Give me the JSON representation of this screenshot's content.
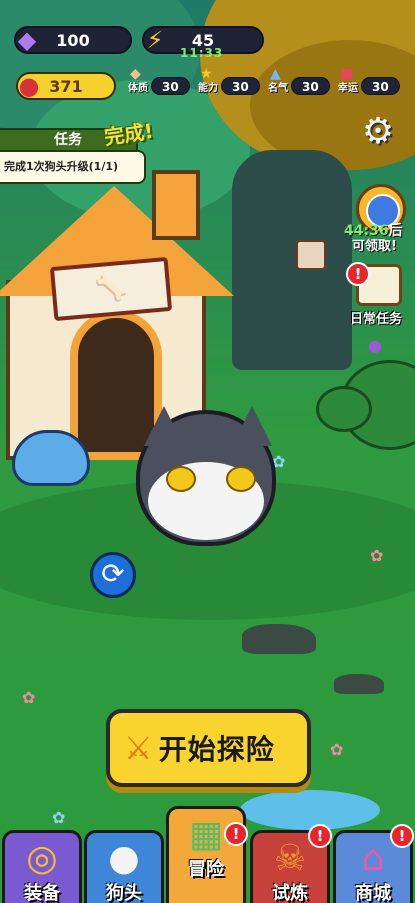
{
  "resources": {
    "gems": "100",
    "energy": "45",
    "energy_timer": "11:33",
    "meat": "371"
  },
  "stats": [
    {
      "label": "体质",
      "value": "30",
      "icon": "muscle-icon"
    },
    {
      "label": "能力",
      "value": "30",
      "icon": "star-icon"
    },
    {
      "label": "名气",
      "value": "30",
      "icon": "fame-icon"
    },
    {
      "label": "幸运",
      "value": "30",
      "icon": "dice-icon"
    }
  ],
  "quest": {
    "title": "任务",
    "description": "完成1次狗头升级(1/1)",
    "status": "完成!"
  },
  "timer_reward": {
    "time": "44:36",
    "suffix": "后",
    "claim_label": "可领取!"
  },
  "daily_task": {
    "label": "日常任务"
  },
  "start_button": {
    "label": "开始探险"
  },
  "nav": {
    "tabs": [
      {
        "label": "装备",
        "icon": "collar-icon",
        "active": false,
        "alert": false
      },
      {
        "label": "狗头",
        "icon": "husky-icon",
        "active": false,
        "alert": false
      },
      {
        "label": "冒险",
        "icon": "map-icon",
        "active": true,
        "alert": true
      },
      {
        "label": "试炼",
        "icon": "fire-skull-icon",
        "active": false,
        "alert": true
      },
      {
        "label": "商城",
        "icon": "shop-icon",
        "active": false,
        "alert": true
      }
    ]
  },
  "colors": {
    "grass": "#2f9a3f",
    "accent_yellow": "#f9d32e",
    "alert_red": "#e8252b",
    "timer_green": "#7af26f"
  }
}
